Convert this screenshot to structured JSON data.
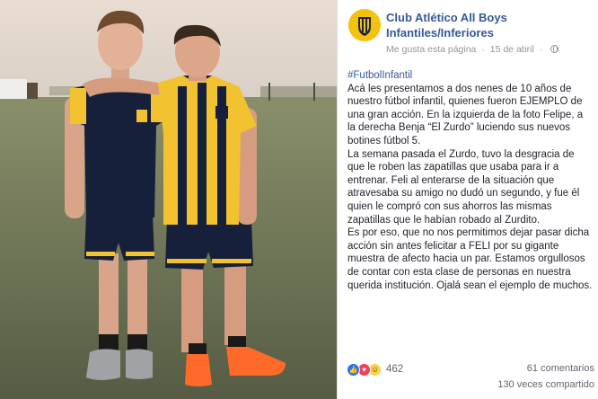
{
  "post": {
    "page_name": "Club Atlético All Boys Infantiles/Inferiores",
    "like_page": "Me gusta esta página",
    "separator": "·",
    "date": "15 de abril",
    "hashtag": "#FutbolInfantil",
    "paragraphs": [
      "Acá les presentamos a dos nenes de 10 años de nuestro fútbol infantil, quienes fueron EJEMPLO de una gran acción. En la izquierda de la foto Felipe, a la derecha Benja “El Zurdo” luciendo sus nuevos botines fútbol 5.",
      "La semana pasada el Zurdo, tuvo la desgracia de que le roben las zapatillas que usaba para ir a entrenar. Feli al enterarse de la situación que atravesaba su amigo no dudó un segundo, y fue él quien le compró con sus ahorros las mismas zapatillas que le habían robado al Zurdito.",
      "Es por eso, que no nos permitimos dejar pasar dicha acción sin antes felicitar a FELI por su gigante muestra de afecto hacia un par. Estamos orgullosos de contar con esta clase de personas en nuestra querida institución. Ojalá sean el ejemplo de muchos."
    ]
  },
  "footer": {
    "reaction_count": "462",
    "comments": "61 comentarios",
    "shares": "130 veces compartido"
  },
  "icons": [
    "like-reaction-icon",
    "love-reaction-icon",
    "haha-reaction-icon",
    "globe-icon",
    "club-crest-icon"
  ],
  "colors": {
    "link_blue": "#365899",
    "meta_gray": "#90949c",
    "kit_yellow": "#f2c230",
    "kit_navy": "#16203a",
    "boot_orange": "#ff6a2a"
  }
}
